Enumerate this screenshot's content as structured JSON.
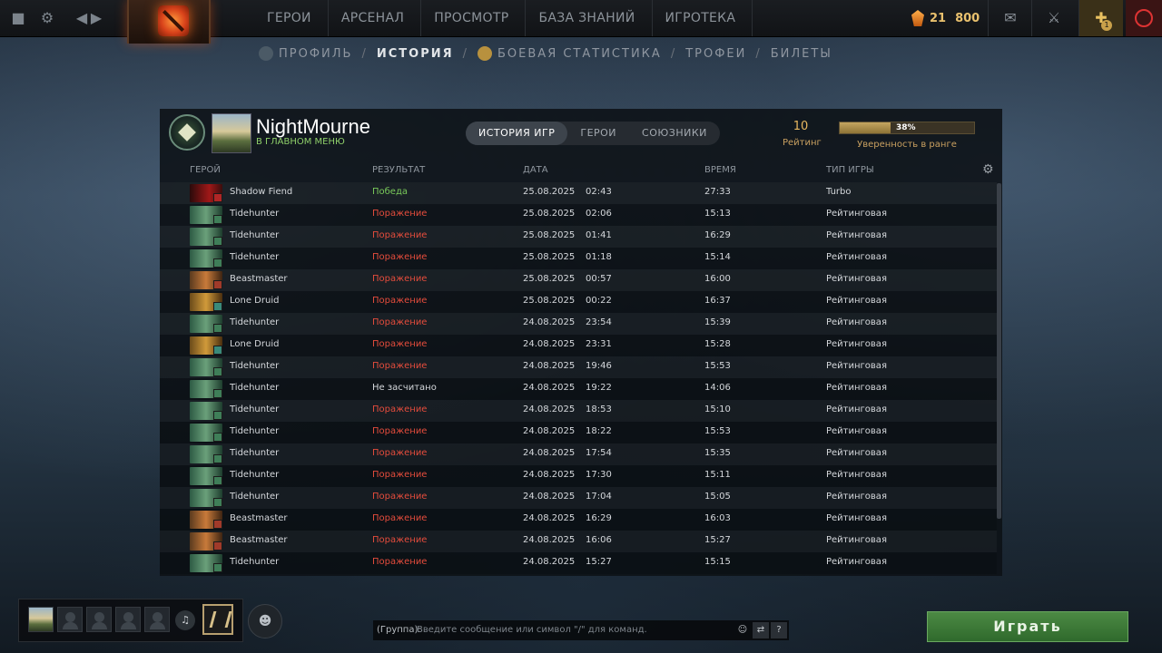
{
  "topnav": {
    "items": [
      {
        "label": "Герои"
      },
      {
        "label": "Арсенал"
      },
      {
        "label": "Просмотр"
      },
      {
        "label": "База знаний"
      },
      {
        "label": "Игротека"
      }
    ],
    "shards_level": "21",
    "shards": "800",
    "notification_count": "1"
  },
  "subnav": {
    "profile": "Профиль",
    "history": "История",
    "stats": "Боевая статистика",
    "trophies": "Трофеи",
    "tickets": "Билеты",
    "separator": "/"
  },
  "player": {
    "name": "NightMourne",
    "status": "В главном меню"
  },
  "tabs": [
    {
      "label": "История игр"
    },
    {
      "label": "Герои"
    },
    {
      "label": "Союзники"
    }
  ],
  "rating": {
    "value": "10",
    "label": "Рейтинг"
  },
  "confidence": {
    "percent": "38%",
    "fraction": 0.38,
    "label": "Уверенность в ранге"
  },
  "table": {
    "headers": {
      "hero": "Герой",
      "result": "Результат",
      "date": "Дата",
      "duration": "Время",
      "type": "Тип игры"
    },
    "rows": [
      {
        "hero": "Shadow Fiend",
        "result": "Победа",
        "date": "25.08.2025",
        "time": "02:43",
        "duration": "27:33",
        "type": "Turbo"
      },
      {
        "hero": "Tidehunter",
        "result": "Поражение",
        "date": "25.08.2025",
        "time": "02:06",
        "duration": "15:13",
        "type": "Рейтинговая"
      },
      {
        "hero": "Tidehunter",
        "result": "Поражение",
        "date": "25.08.2025",
        "time": "01:41",
        "duration": "16:29",
        "type": "Рейтинговая"
      },
      {
        "hero": "Tidehunter",
        "result": "Поражение",
        "date": "25.08.2025",
        "time": "01:18",
        "duration": "15:14",
        "type": "Рейтинговая"
      },
      {
        "hero": "Beastmaster",
        "result": "Поражение",
        "date": "25.08.2025",
        "time": "00:57",
        "duration": "16:00",
        "type": "Рейтинговая"
      },
      {
        "hero": "Lone Druid",
        "result": "Поражение",
        "date": "25.08.2025",
        "time": "00:22",
        "duration": "16:37",
        "type": "Рейтинговая"
      },
      {
        "hero": "Tidehunter",
        "result": "Поражение",
        "date": "24.08.2025",
        "time": "23:54",
        "duration": "15:39",
        "type": "Рейтинговая"
      },
      {
        "hero": "Lone Druid",
        "result": "Поражение",
        "date": "24.08.2025",
        "time": "23:31",
        "duration": "15:28",
        "type": "Рейтинговая"
      },
      {
        "hero": "Tidehunter",
        "result": "Поражение",
        "date": "24.08.2025",
        "time": "19:46",
        "duration": "15:53",
        "type": "Рейтинговая"
      },
      {
        "hero": "Tidehunter",
        "result": "Не засчитано",
        "date": "24.08.2025",
        "time": "19:22",
        "duration": "14:06",
        "type": "Рейтинговая"
      },
      {
        "hero": "Tidehunter",
        "result": "Поражение",
        "date": "24.08.2025",
        "time": "18:53",
        "duration": "15:10",
        "type": "Рейтинговая"
      },
      {
        "hero": "Tidehunter",
        "result": "Поражение",
        "date": "24.08.2025",
        "time": "18:22",
        "duration": "15:53",
        "type": "Рейтинговая"
      },
      {
        "hero": "Tidehunter",
        "result": "Поражение",
        "date": "24.08.2025",
        "time": "17:54",
        "duration": "15:35",
        "type": "Рейтинговая"
      },
      {
        "hero": "Tidehunter",
        "result": "Поражение",
        "date": "24.08.2025",
        "time": "17:30",
        "duration": "15:11",
        "type": "Рейтинговая"
      },
      {
        "hero": "Tidehunter",
        "result": "Поражение",
        "date": "24.08.2025",
        "time": "17:04",
        "duration": "15:05",
        "type": "Рейтинговая"
      },
      {
        "hero": "Beastmaster",
        "result": "Поражение",
        "date": "24.08.2025",
        "time": "16:29",
        "duration": "16:03",
        "type": "Рейтинговая"
      },
      {
        "hero": "Beastmaster",
        "result": "Поражение",
        "date": "24.08.2025",
        "time": "16:06",
        "duration": "15:27",
        "type": "Рейтинговая"
      },
      {
        "hero": "Tidehunter",
        "result": "Поражение",
        "date": "24.08.2025",
        "time": "15:27",
        "duration": "15:15",
        "type": "Рейтинговая"
      }
    ]
  },
  "chat": {
    "channel": "(Группа):",
    "placeholder": "Введите сообщение или символ \"/\" для команд.",
    "help": "?"
  },
  "play_button": "Играть",
  "colors": {
    "win": "#79c95a",
    "loss": "#e44c3c",
    "accent": "#e8b860"
  }
}
